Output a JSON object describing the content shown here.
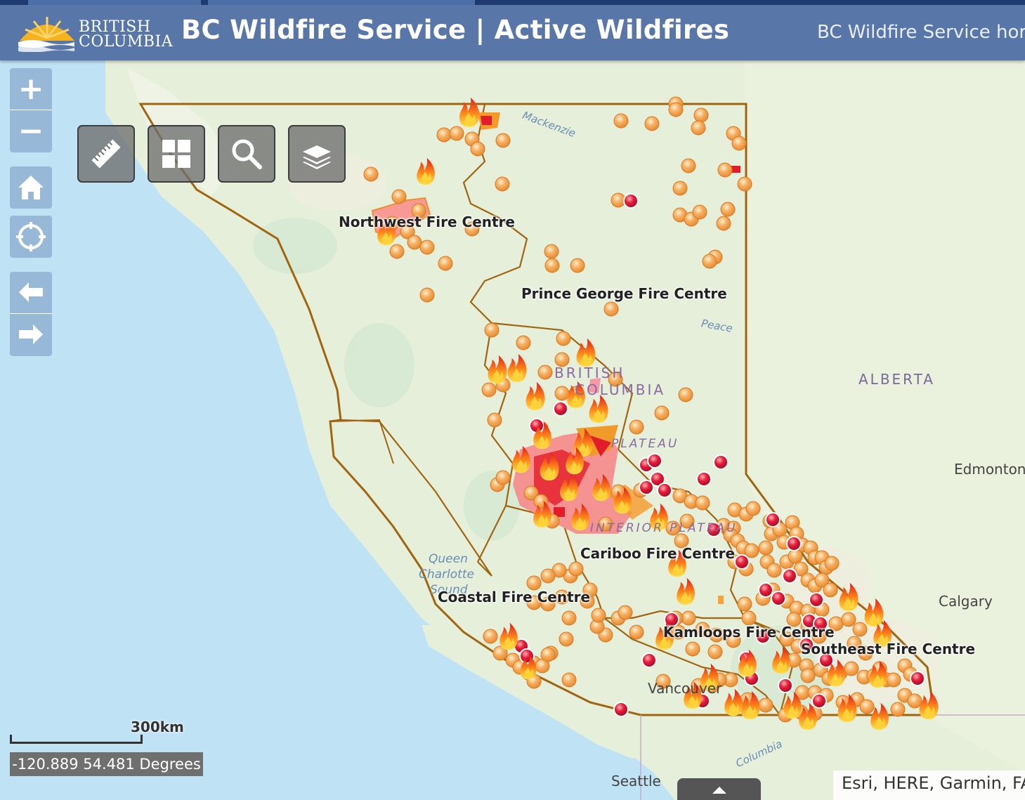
{
  "header": {
    "logo_line1": "BRITISH",
    "logo_line2": "COLUMBIA",
    "title": "BC Wildfire Service | Active Wildfires",
    "home_link": "BC Wildfire Service hor"
  },
  "controls": {
    "zoom_in": "+",
    "zoom_out": "−",
    "icons": [
      "home-icon",
      "locate-icon",
      "back-arrow-icon",
      "forward-arrow-icon"
    ],
    "toolbar_icons": [
      "measure-ruler-icon",
      "basemap-gallery-icon",
      "search-icon",
      "layers-icon"
    ]
  },
  "map_labels": {
    "northwest_fc": "Northwest Fire Centre",
    "prince_george_fc": "Prince George Fire Centre",
    "cariboo_fc": "Cariboo Fire Centre",
    "coastal_fc": "Coastal Fire Centre",
    "kamloops_fc": "Kamloops Fire Centre",
    "southeast_fc": "Southeast Fire Centre",
    "british": "BRITISH",
    "columbia": "COLUMBIA",
    "plateau": "PLATEAU",
    "interior": "INTERIOR PLATEAU",
    "alberta": "ALBERTA",
    "edmonton": "Edmonton",
    "calgary": "Calgary",
    "vancouver": "Vancouver",
    "seattle": "Seattle",
    "queen_charlotte_1": "Queen",
    "queen_charlotte_2": "Charlotte",
    "queen_charlotte_3": "Sound",
    "mackenzie": "Mackenzie",
    "peace": "Peace",
    "columbia_river": "Columbia"
  },
  "scale": {
    "label": "300km"
  },
  "coordinates": "-120.889 54.481 Degrees",
  "attribution": "Esri, HERE, Garmin, FA",
  "colors": {
    "header": "#5876a8",
    "boundary": "#a0650e",
    "fire_orange": "#f5a34a",
    "fire_red": "#e01b3a",
    "water": "#bfe3f5",
    "land": "#e6efd9"
  },
  "legend_symbols": [
    "wildfire-of-note-flame",
    "active-fire-orange-dot",
    "new-fire-red-dot",
    "fire-perimeter-polygon"
  ]
}
